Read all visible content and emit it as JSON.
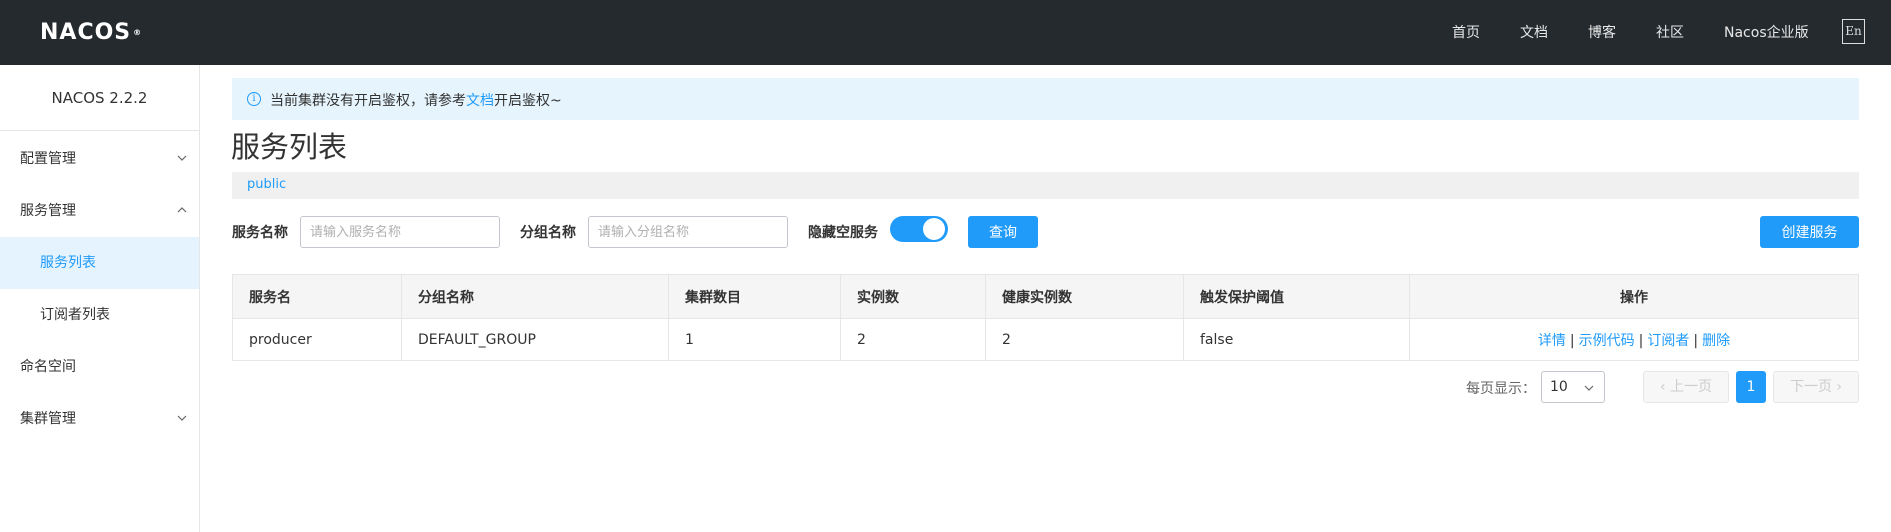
{
  "topbar": {
    "logo": "NACOS",
    "logo_mark": "®",
    "nav": [
      "首页",
      "文档",
      "博客",
      "社区",
      "Nacos企业版"
    ],
    "lang": "En"
  },
  "sidebar": {
    "version": "NACOS 2.2.2",
    "items": [
      {
        "label": "配置管理",
        "expandable": true
      },
      {
        "label": "服务管理",
        "expandable": true
      },
      {
        "label": "服务列表",
        "active": true
      },
      {
        "label": "订阅者列表"
      },
      {
        "label": "命名空间"
      },
      {
        "label": "集群管理",
        "expandable": true
      }
    ]
  },
  "notice": {
    "icon": "info-icon",
    "text_before": "当前集群没有开启鉴权，请参考",
    "link": "文档",
    "text_after": "开启鉴权~"
  },
  "page": {
    "title": "服务列表",
    "namespace": "public"
  },
  "filters": {
    "service_name_label": "服务名称",
    "service_name_placeholder": "请输入服务名称",
    "group_name_label": "分组名称",
    "group_name_placeholder": "请输入分组名称",
    "hide_empty_label": "隐藏空服务",
    "hide_empty_on": true,
    "query_button": "查询",
    "create_button": "创建服务"
  },
  "table": {
    "columns": [
      "服务名",
      "分组名称",
      "集群数目",
      "实例数",
      "健康实例数",
      "触发保护阈值",
      "操作"
    ],
    "rows": [
      {
        "service": "producer",
        "group": "DEFAULT_GROUP",
        "clusters": "1",
        "instances": "2",
        "healthy": "2",
        "threshold": "false"
      }
    ],
    "actions": [
      "详情",
      "示例代码",
      "订阅者",
      "删除"
    ],
    "action_separator": "|"
  },
  "pagination": {
    "page_size_label": "每页显示：",
    "page_size": "10",
    "prev": "上一页",
    "next": "下一页",
    "current_page": "1"
  },
  "colors": {
    "primary": "#209bfa",
    "topbar": "#252a2f",
    "notice_bg": "#e6f4fd",
    "active_bg": "#e5f3ff"
  }
}
